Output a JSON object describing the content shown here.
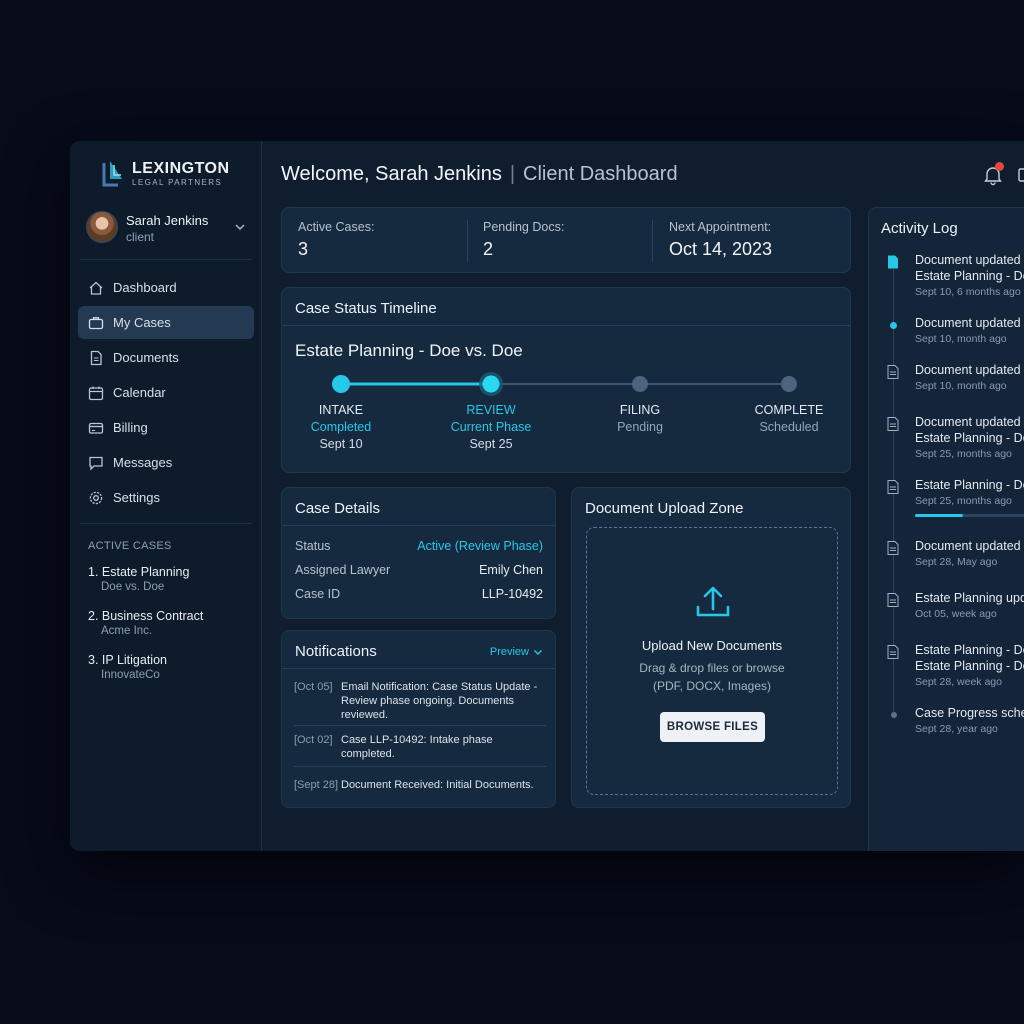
{
  "brand": {
    "name": "LEXINGTON",
    "tagline": "LEGAL PARTNERS"
  },
  "user": {
    "name": "Sarah Jenkins",
    "role": "client"
  },
  "nav": [
    {
      "label": "Dashboard",
      "icon": "home-icon"
    },
    {
      "label": "My Cases",
      "icon": "briefcase-icon",
      "active": true
    },
    {
      "label": "Documents",
      "icon": "document-icon"
    },
    {
      "label": "Calendar",
      "icon": "calendar-icon"
    },
    {
      "label": "Billing",
      "icon": "credit-card-icon"
    },
    {
      "label": "Messages",
      "icon": "chat-icon"
    },
    {
      "label": "Settings",
      "icon": "gear-icon"
    }
  ],
  "active_cases": {
    "label": "ACTIVE CASES",
    "items": [
      {
        "title": "1. Estate Planning",
        "party": "Doe vs. Doe"
      },
      {
        "title": "2. Business Contract",
        "party": "Acme Inc."
      },
      {
        "title": "3. IP Litigation",
        "party": "InnovateCo"
      }
    ]
  },
  "header": {
    "welcome": "Welcome, Sarah Jenkins",
    "separator": "|",
    "subtitle": "Client Dashboard"
  },
  "stats": [
    {
      "label": "Active Cases:",
      "value": "3"
    },
    {
      "label": "Pending Docs:",
      "value": "2"
    },
    {
      "label": "Next Appointment:",
      "value": "Oct 14, 2023"
    }
  ],
  "timeline": {
    "title": "Case Status Timeline",
    "case_name": "Estate Planning - Doe vs. Doe",
    "phases": [
      {
        "name": "INTAKE",
        "status": "Completed",
        "date": "Sept 10"
      },
      {
        "name": "REVIEW",
        "status": "Current Phase",
        "date": "Sept 25"
      },
      {
        "name": "FILING",
        "status": "Pending",
        "date": ""
      },
      {
        "name": "COMPLETE",
        "status": "Scheduled",
        "date": ""
      }
    ],
    "colors": {
      "done": "#27c7e8",
      "pending": "#4b6480"
    }
  },
  "case_details": {
    "title": "Case Details",
    "rows": [
      {
        "key": "Status",
        "value": "Active (Review Phase)"
      },
      {
        "key": "Assigned Lawyer",
        "value": "Emily Chen"
      },
      {
        "key": "Case ID",
        "value": "LLP-10492"
      }
    ]
  },
  "notifications": {
    "title": "Notifications",
    "filter": "Preview",
    "items": [
      {
        "date": "[Oct 05]",
        "text": "Email Notification: Case Status Update - Review phase ongoing. Documents reviewed."
      },
      {
        "date": "[Oct 02]",
        "text": "Case LLP-10492: Intake phase completed."
      },
      {
        "date": "[Sept 28]",
        "text": "Document Received: Initial Documents."
      }
    ]
  },
  "upload": {
    "title": "Document Upload Zone",
    "heading": "Upload New Documents",
    "line1": "Drag & drop files or browse",
    "line2": "(PDF, DOCX, Images)",
    "button": "BROWSE FILES"
  },
  "activity": {
    "title": "Activity Log",
    "items": [
      {
        "icon": "file-filled-icon",
        "lines": [
          "Document updated",
          "Estate Planning - Do"
        ],
        "meta": "Sept 10, 6 months ago"
      },
      {
        "icon": "dot-icon",
        "lines": [
          "Document updated"
        ],
        "meta": "Sept 10, month ago"
      },
      {
        "icon": "document-icon",
        "lines": [
          "Document updated"
        ],
        "meta": "Sept 10, month ago"
      },
      {
        "icon": "document-icon",
        "lines": [
          "Document updated",
          "Estate Planning - Do"
        ],
        "meta": "Sept 25, months ago"
      },
      {
        "icon": "document-icon",
        "lines": [
          "Estate Planning - Do"
        ],
        "meta": "Sept 25, months ago",
        "progress": 0.4
      },
      {
        "icon": "document-icon",
        "lines": [
          "Document updated"
        ],
        "meta": "Sept 28, May ago"
      },
      {
        "icon": "document-icon",
        "lines": [
          "Estate Planning upd"
        ],
        "meta": "Oct 05, week ago"
      },
      {
        "icon": "document-icon",
        "lines": [
          "Estate Planning - Do",
          "Estate Planning - Do"
        ],
        "meta": "Sept 28, week ago"
      },
      {
        "icon": "dot-icon",
        "lines": [
          "Case Progress sche"
        ],
        "meta": "Sept 28, year ago"
      }
    ]
  }
}
